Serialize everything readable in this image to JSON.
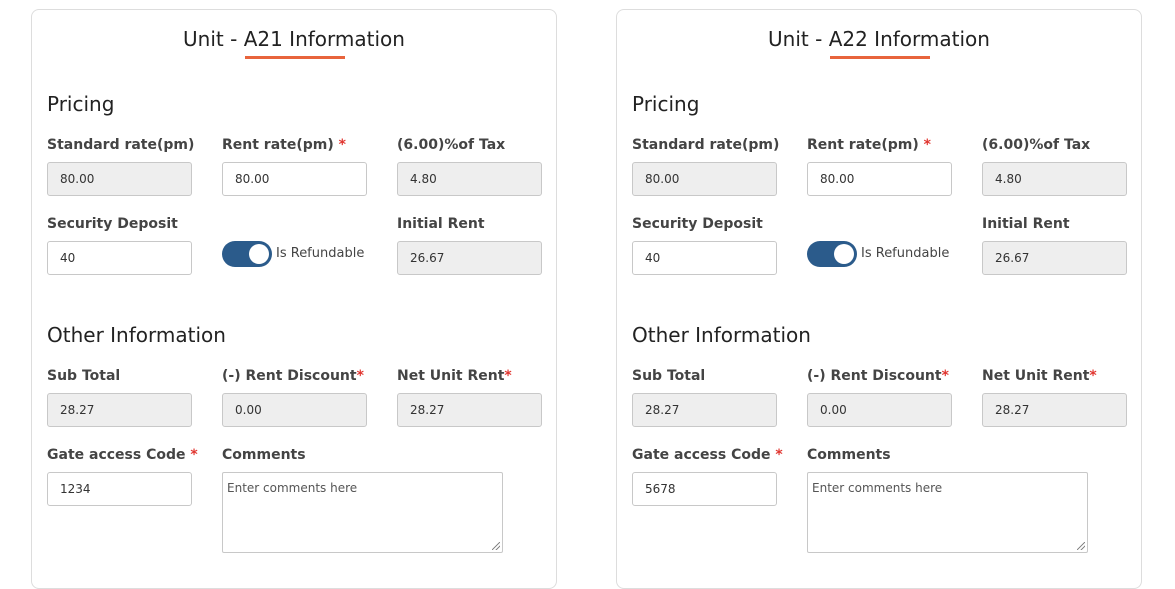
{
  "units": [
    {
      "title": "Unit - A21 Information",
      "pricing_title": "Pricing",
      "standard_rate_label": "Standard rate(pm)",
      "standard_rate_value": "80.00",
      "rent_rate_label": "Rent rate(pm)",
      "rent_rate_value": "80.00",
      "tax_label": "(6.00)%of Tax",
      "tax_value": "4.80",
      "security_deposit_label": "Security Deposit",
      "security_deposit_value": "40",
      "refundable_label": "Is Refundable",
      "refundable_on": true,
      "initial_rent_label": "Initial Rent",
      "initial_rent_value": "26.67",
      "other_title": "Other Information",
      "sub_total_label": "Sub Total",
      "sub_total_value": "28.27",
      "rent_discount_label": "(-) Rent Discount",
      "rent_discount_value": "0.00",
      "net_unit_rent_label": "Net Unit Rent",
      "net_unit_rent_value": "28.27",
      "gate_code_label": "Gate access Code",
      "gate_code_value": "1234",
      "comments_label": "Comments",
      "comments_placeholder": "Enter comments here",
      "required_mark": "*"
    },
    {
      "title": "Unit - A22 Information",
      "pricing_title": "Pricing",
      "standard_rate_label": "Standard rate(pm)",
      "standard_rate_value": "80.00",
      "rent_rate_label": "Rent rate(pm)",
      "rent_rate_value": "80.00",
      "tax_label": "(6.00)%of Tax",
      "tax_value": "4.80",
      "security_deposit_label": "Security Deposit",
      "security_deposit_value": "40",
      "refundable_label": "Is Refundable",
      "refundable_on": true,
      "initial_rent_label": "Initial Rent",
      "initial_rent_value": "26.67",
      "other_title": "Other Information",
      "sub_total_label": "Sub Total",
      "sub_total_value": "28.27",
      "rent_discount_label": "(-) Rent Discount",
      "rent_discount_value": "0.00",
      "net_unit_rent_label": "Net Unit Rent",
      "net_unit_rent_value": "28.27",
      "gate_code_label": "Gate access Code",
      "gate_code_value": "5678",
      "comments_label": "Comments",
      "comments_placeholder": "Enter comments here",
      "required_mark": "*"
    }
  ],
  "colors": {
    "accent": "#e8643c",
    "toggle_on": "#2b5b8b",
    "required": "#e0342e",
    "readonly_bg": "#eeeeee"
  }
}
